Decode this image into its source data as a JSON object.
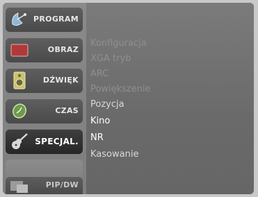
{
  "sidebar": {
    "items": [
      {
        "label": "PROGRAM",
        "icon": "satellite-dish-icon"
      },
      {
        "label": "OBRAZ",
        "icon": "picture-icon"
      },
      {
        "label": "DŹWIĘK",
        "icon": "speaker-icon"
      },
      {
        "label": "CZAS",
        "icon": "clock-icon"
      },
      {
        "label": "SPECJAL.",
        "icon": "guitar-icon"
      },
      {
        "label": "PIP/DW",
        "icon": "pip-icon"
      }
    ]
  },
  "submenu": {
    "items": [
      "Konfiguracja",
      "XGA tryb",
      "ARC",
      "Powiększenie",
      "Pozycja",
      "Kino",
      "NR",
      "Kasowanie"
    ]
  }
}
